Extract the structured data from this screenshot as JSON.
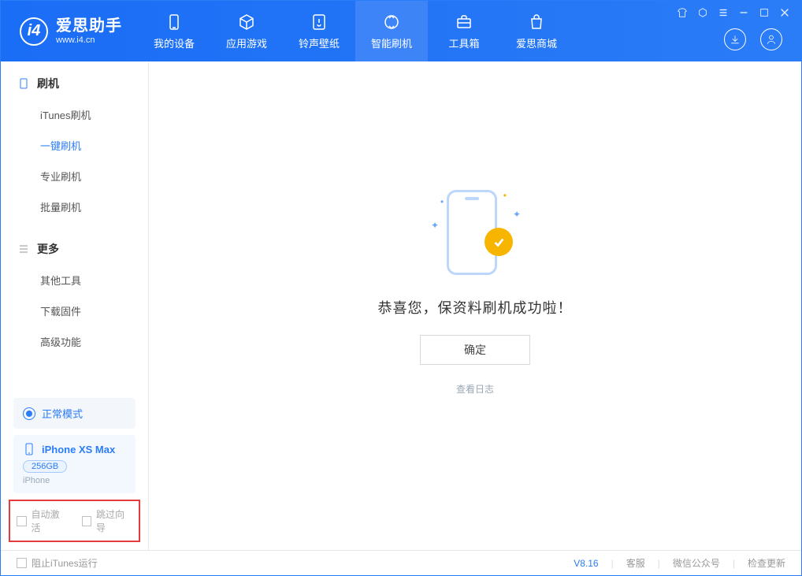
{
  "app": {
    "title": "爱思助手",
    "subtitle": "www.i4.cn"
  },
  "nav": {
    "items": [
      {
        "id": "my_device",
        "label": "我的设备"
      },
      {
        "id": "apps_games",
        "label": "应用游戏"
      },
      {
        "id": "ring_wallpaper",
        "label": "铃声壁纸"
      },
      {
        "id": "smart_flash",
        "label": "智能刷机",
        "active": true
      },
      {
        "id": "toolbox",
        "label": "工具箱"
      },
      {
        "id": "i4_mall",
        "label": "爱思商城"
      }
    ]
  },
  "sidebar": {
    "flash": {
      "title": "刷机",
      "items": [
        {
          "id": "itunes_flash",
          "label": "iTunes刷机"
        },
        {
          "id": "one_click",
          "label": "一键刷机",
          "active": true
        },
        {
          "id": "pro_flash",
          "label": "专业刷机"
        },
        {
          "id": "batch_flash",
          "label": "批量刷机"
        }
      ]
    },
    "more": {
      "title": "更多",
      "items": [
        {
          "id": "other_tools",
          "label": "其他工具"
        },
        {
          "id": "download_fw",
          "label": "下载固件"
        },
        {
          "id": "advanced",
          "label": "高级功能"
        }
      ]
    },
    "mode": {
      "label": "正常模式"
    },
    "device": {
      "name": "iPhone XS Max",
      "storage": "256GB",
      "type": "iPhone"
    },
    "options": {
      "auto_activate": "自动激活",
      "skip_guide": "跳过向导"
    }
  },
  "main": {
    "success_text": "恭喜您，保资料刷机成功啦！",
    "ok_button": "确定",
    "view_log": "查看日志"
  },
  "status": {
    "block_itunes": "阻止iTunes运行",
    "version": "V8.16",
    "support": "客服",
    "wechat": "微信公众号",
    "check_update": "检查更新"
  }
}
